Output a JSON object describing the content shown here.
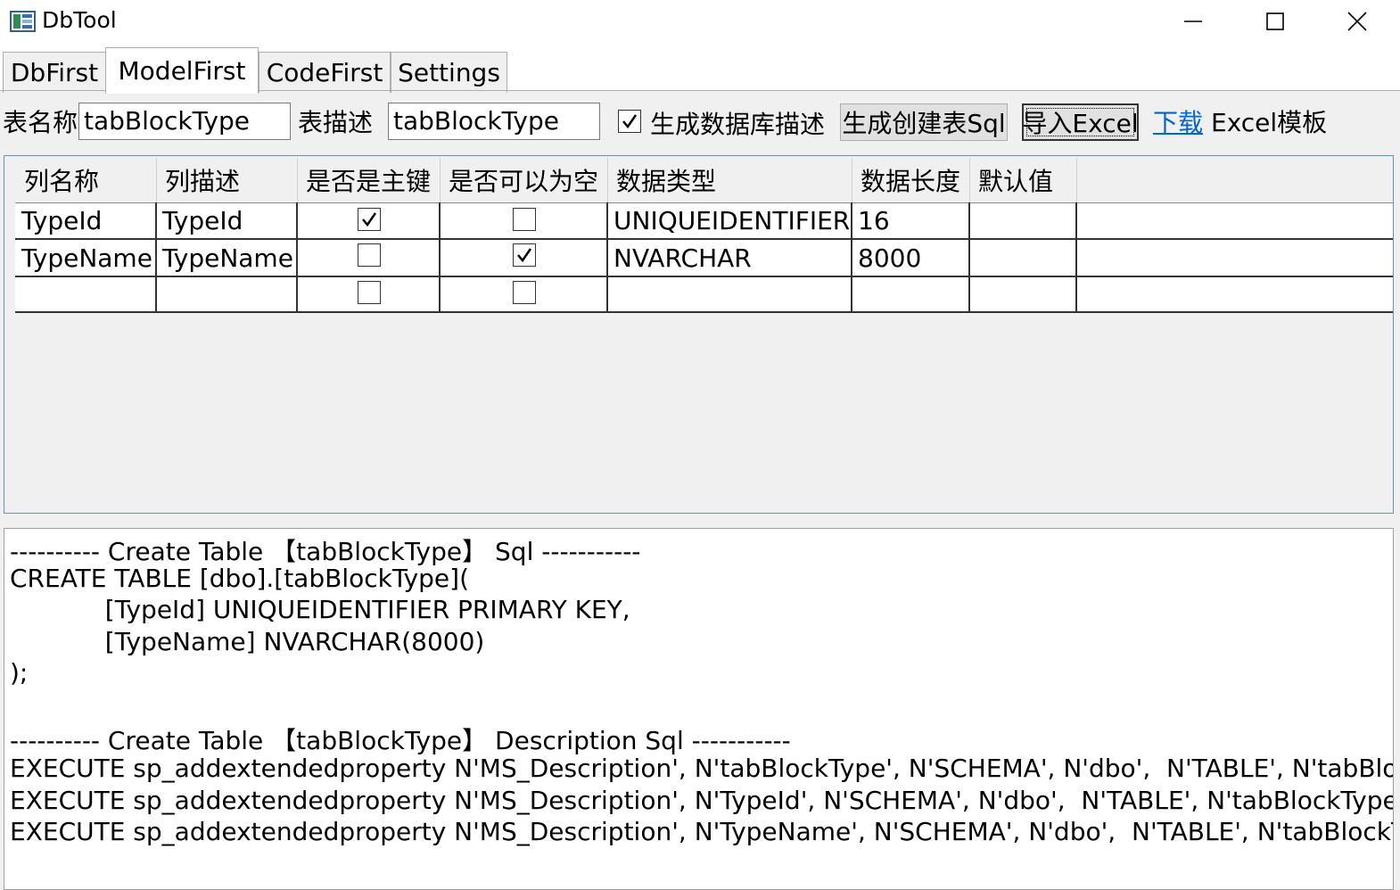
{
  "window": {
    "title": "DbTool",
    "controls": [
      "minimize",
      "maximize",
      "close"
    ]
  },
  "tabs": [
    {
      "label": "DbFirst",
      "active": false
    },
    {
      "label": "ModelFirst",
      "active": true
    },
    {
      "label": "CodeFirst",
      "active": false
    },
    {
      "label": "Settings",
      "active": false
    }
  ],
  "toolbar": {
    "table_name_label": "表名称",
    "table_name_value": "tabBlockType",
    "table_desc_label": "表描述",
    "table_desc_value": "tabBlockType",
    "gen_desc_checked": true,
    "gen_desc_label": "生成数据库描述",
    "gen_sql_button": "生成创建表Sql",
    "import_excel_button": "导入Excel",
    "download_link": "下载",
    "excel_template_label": "Excel模板"
  },
  "grid": {
    "headers": [
      "列名称",
      "列描述",
      "是否是主键",
      "是否可以为空",
      "数据类型",
      "数据长度",
      "默认值"
    ],
    "rows": [
      {
        "name": "TypeId",
        "desc": "TypeId",
        "pk": true,
        "nullable": false,
        "type": "UNIQUEIDENTIFIER",
        "length": "16",
        "default": ""
      },
      {
        "name": "TypeName",
        "desc": "TypeName",
        "pk": false,
        "nullable": true,
        "type": "NVARCHAR",
        "length": "8000",
        "default": ""
      },
      {
        "name": "",
        "desc": "",
        "pk": false,
        "nullable": false,
        "type": "",
        "length": "",
        "default": ""
      }
    ]
  },
  "sql_output": {
    "lines": [
      "---------- Create Table 【tabBlockType】 Sql -----------",
      "CREATE TABLE [dbo].[tabBlockType](",
      "            [TypeId] UNIQUEIDENTIFIER PRIMARY KEY,",
      "            [TypeName] NVARCHAR(8000)",
      ");",
      "",
      "---------- Create Table 【tabBlockType】 Description Sql -----------",
      "EXECUTE sp_addextendedproperty N'MS_Description', N'tabBlockType', N'SCHEMA', N'dbo',  N'TABLE', N'tabBlockType';",
      "EXECUTE sp_addextendedproperty N'MS_Description', N'TypeId', N'SCHEMA', N'dbo',  N'TABLE', N'tabBlockType', N'COLUMN', N'TypeId';",
      "EXECUTE sp_addextendedproperty N'MS_Description', N'TypeName', N'SCHEMA', N'dbo',  N'TABLE', N'tabBlockType', N'COLUMN', N'TypeName';"
    ]
  }
}
